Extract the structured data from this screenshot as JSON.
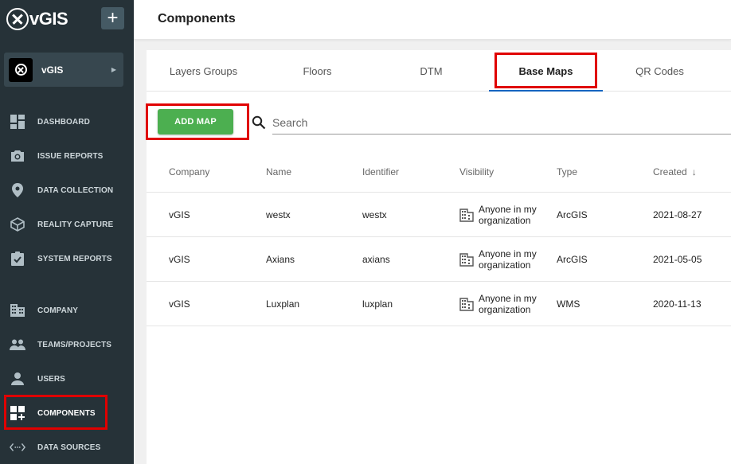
{
  "app": {
    "logo_text": "vGIS",
    "add_symbol": "+"
  },
  "org": {
    "name": "vGIS",
    "arrow": "▶"
  },
  "sidebar": {
    "items": [
      {
        "label": "DASHBOARD",
        "icon": "dashboard-icon"
      },
      {
        "label": "ISSUE REPORTS",
        "icon": "camera-icon"
      },
      {
        "label": "DATA COLLECTION",
        "icon": "location-pin-icon"
      },
      {
        "label": "REALITY CAPTURE",
        "icon": "reality-capture-icon"
      },
      {
        "label": "SYSTEM REPORTS",
        "icon": "clipboard-check-icon"
      },
      {
        "label": "COMPANY",
        "icon": "building-icon"
      },
      {
        "label": "TEAMS/PROJECTS",
        "icon": "people-icon"
      },
      {
        "label": "USERS",
        "icon": "person-icon"
      },
      {
        "label": "COMPONENTS",
        "icon": "components-icon",
        "active": true
      },
      {
        "label": "DATA SOURCES",
        "icon": "code-icon"
      }
    ]
  },
  "header": {
    "title": "Components"
  },
  "tabs": [
    {
      "label": "Layers Groups"
    },
    {
      "label": "Floors"
    },
    {
      "label": "DTM"
    },
    {
      "label": "Base Maps",
      "active": true
    },
    {
      "label": "QR Codes"
    }
  ],
  "toolbar": {
    "add_label": "ADD MAP",
    "search_placeholder": "Search"
  },
  "table": {
    "columns": [
      "Company",
      "Name",
      "Identifier",
      "Visibility",
      "Type",
      "Created"
    ],
    "sort_indicator": "↓",
    "rows": [
      {
        "company": "vGIS",
        "name": "westx",
        "identifier": "westx",
        "visibility": "Anyone in my organization",
        "type": "ArcGIS",
        "created": "2021-08-27"
      },
      {
        "company": "vGIS",
        "name": "Axians",
        "identifier": "axians",
        "visibility": "Anyone in my organization",
        "type": "ArcGIS",
        "created": "2021-05-05"
      },
      {
        "company": "vGIS",
        "name": "Luxplan",
        "identifier": "luxplan",
        "visibility": "Anyone in my organization",
        "type": "WMS",
        "created": "2020-11-13"
      }
    ]
  },
  "colors": {
    "sidebar_bg": "#263238",
    "accent_green": "#4caf50",
    "tab_underline": "#1565c0",
    "highlight_red": "#e00000"
  }
}
